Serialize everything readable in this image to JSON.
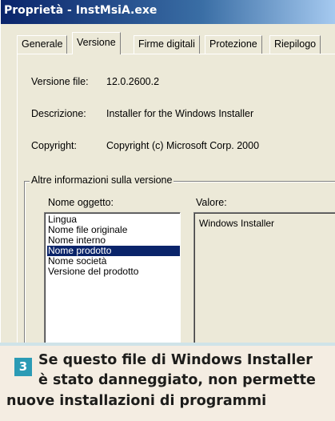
{
  "window": {
    "title": "Proprietà - InstMsiA.exe"
  },
  "tabs": [
    {
      "label": "Generale",
      "active": false
    },
    {
      "label": "Versione",
      "active": true
    },
    {
      "label": "Firme digitali",
      "active": false
    },
    {
      "label": "Protezione",
      "active": false
    },
    {
      "label": "Riepilogo",
      "active": false
    }
  ],
  "version_info": {
    "file_version_label": "Versione file:",
    "file_version_value": "12.0.2600.2",
    "description_label": "Descrizione:",
    "description_value": "Installer for the Windows Installer",
    "copyright_label": "Copyright:",
    "copyright_value": "Copyright (c) Microsoft Corp. 2000"
  },
  "other_info": {
    "group_title": "Altre informazioni sulla versione",
    "item_name_label": "Nome oggetto:",
    "value_label": "Valore:",
    "items": [
      {
        "label": "Lingua",
        "selected": false
      },
      {
        "label": "Nome file originale",
        "selected": false
      },
      {
        "label": "Nome interno",
        "selected": false
      },
      {
        "label": "Nome prodotto",
        "selected": true
      },
      {
        "label": "Nome società",
        "selected": false
      },
      {
        "label": "Versione del prodotto",
        "selected": false
      }
    ],
    "selected_value": "Windows Installer"
  },
  "caption": {
    "step_number": "3",
    "line1": "Se questo file di Windows Installer",
    "line2": "è stato danneggiato, non permette",
    "line3": "nuove installazioni di programmi"
  },
  "colors": {
    "title_bar": "#0a246a",
    "selection": "#0a246a",
    "badge": "#2b9bb5",
    "caption_background": "#f4ede2"
  }
}
